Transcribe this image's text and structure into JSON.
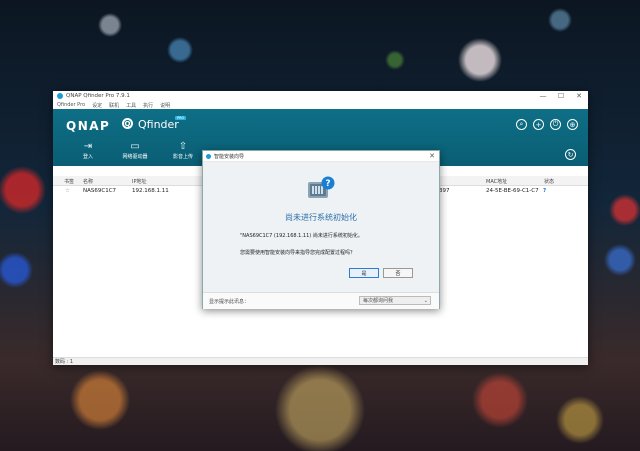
{
  "window": {
    "title": "QNAP Qfinder Pro 7.9.1",
    "menu": [
      "Qfinder Pro",
      "设定",
      "联机",
      "工具",
      "执行",
      "说明"
    ],
    "controls": [
      "—",
      "☐",
      "✕"
    ]
  },
  "toolbar": {
    "brand": "QNAP",
    "app_name": "Qfinder",
    "pro_badge": "PRO",
    "items": [
      {
        "label": "登入",
        "icon": "⇥"
      },
      {
        "label": "网络驱动器",
        "icon": "▭"
      },
      {
        "label": "影音上传",
        "icon": "⇧"
      }
    ]
  },
  "table": {
    "columns": [
      "书签",
      "名称",
      "IP地址",
      "MAC地址",
      "状态"
    ],
    "row": {
      "star": "☆",
      "name": "NAS69C1C7",
      "ip": "192.168.1.11",
      "partial": "397",
      "mac": "24-5E-BE-69-C1-C7",
      "status": "?"
    }
  },
  "status_bar": "数码 : 1",
  "dialog": {
    "title": "智能安装向导",
    "heading": "尚未进行系统初始化",
    "message1": "\"NAS69C1C7 (192.168.1.11) 尚未进行系统初始化。",
    "message2": "您需要使用智能安装向导来指导您完成配置过程吗？",
    "yes": "是",
    "no": "否",
    "footer_label": "显示提示此讯息：",
    "footer_select": "每次都询问我"
  }
}
